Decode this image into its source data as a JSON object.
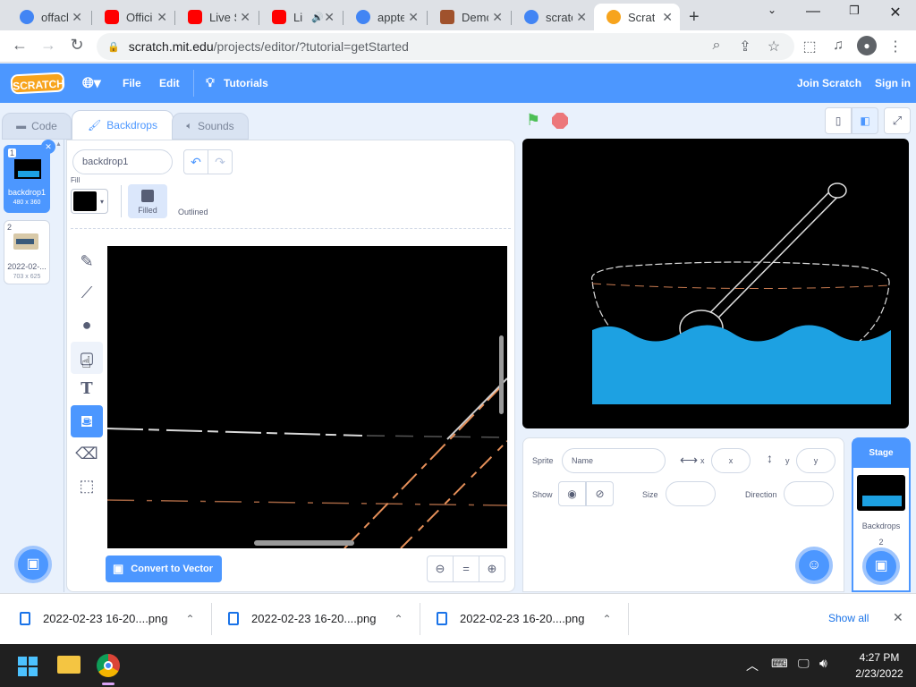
{
  "browser": {
    "tabs": [
      {
        "title": "offacl",
        "color": "#4285f4"
      },
      {
        "title": "Offici",
        "color": "#ff0000"
      },
      {
        "title": "Live S",
        "color": "#ff0000"
      },
      {
        "title": "Li",
        "color": "#ff0000"
      },
      {
        "title": "appte",
        "color": "#4285f4"
      },
      {
        "title": "Demc",
        "color": "#a0522d"
      },
      {
        "title": "scratc",
        "color": "#4285f4"
      },
      {
        "title": "Scratc",
        "color": "#f7a41d"
      }
    ],
    "new_tab": "+",
    "url_host": "scratch.mit.edu",
    "url_path": "/projects/editor/?tutorial=getStarted"
  },
  "menu": {
    "logo": "SCRATCH",
    "file": "File",
    "edit": "Edit",
    "tutorials": "Tutorials",
    "join": "Join Scratch",
    "signin": "Sign in"
  },
  "tabs": {
    "code": "Code",
    "backdrops": "Backdrops",
    "sounds": "Sounds"
  },
  "costumes": [
    {
      "num": "1",
      "name": "backdrop1",
      "size": "480 x 360"
    },
    {
      "num": "2",
      "name": "2022-02-...",
      "size": "703 x 625"
    }
  ],
  "paint": {
    "costume_name": "backdrop1",
    "fill_label": "Fill",
    "fill_color": "#000000",
    "filled": "Filled",
    "outlined": "Outlined",
    "convert": "Convert to Vector",
    "zoom_equal": "="
  },
  "sprite_info": {
    "sprite_label": "Sprite",
    "name_placeholder": "Name",
    "x_label": "x",
    "x_placeholder": "x",
    "y_label": "y",
    "y_placeholder": "y",
    "show_label": "Show",
    "size_label": "Size",
    "direction_label": "Direction"
  },
  "stage_panel": {
    "title": "Stage",
    "backdrops_label": "Backdrops",
    "backdrops_count": "2"
  },
  "downloads": {
    "items": [
      "2022-02-23 16-20....png",
      "2022-02-23 16-20....png",
      "2022-02-23 16-20....png"
    ],
    "show_all": "Show all"
  },
  "taskbar": {
    "time": "4:27 PM",
    "date": "2/23/2022"
  },
  "colors": {
    "scratch_blue": "#4c97ff",
    "water": "#1da1e2"
  }
}
